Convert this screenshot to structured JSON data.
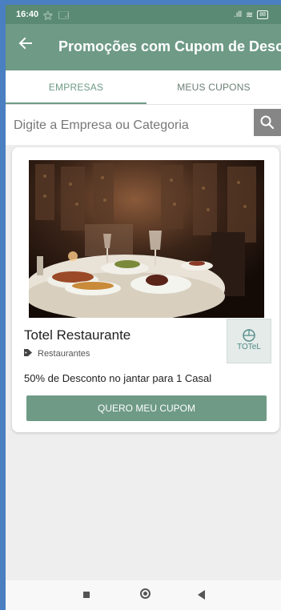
{
  "status_bar": {
    "time": "16:40",
    "left_icons": "⚝ 🗔",
    "signal": ".ıll",
    "wifi": "≋",
    "battery": "88"
  },
  "app_bar": {
    "back_icon": "arrow-left",
    "title": "Promoções com Cupom de Desc..."
  },
  "tabs": [
    {
      "label": "EMPRESAS",
      "selected": true
    },
    {
      "label": "MEUS CUPONS",
      "selected": false
    }
  ],
  "search": {
    "placeholder": "Digite a Empresa ou Categoria",
    "value": "",
    "icon": "search-icon"
  },
  "coupon_card": {
    "image": "restaurant-table-photo",
    "business_name": "Totel Restaurante",
    "category_icon": "tag-icon",
    "category": "Restaurantes",
    "logo_text": "TOTeL",
    "description": "50% de Desconto no jantar para 1 Casal",
    "button_label": "QUERO MEU CUPOM"
  },
  "nav_bar": {
    "recent": "square",
    "home": "circle",
    "back": "triangle"
  },
  "colors": {
    "primary": "#6e9a86",
    "status_bar": "#5a8a73",
    "search_button": "#868686",
    "background": "#eeeeee"
  }
}
